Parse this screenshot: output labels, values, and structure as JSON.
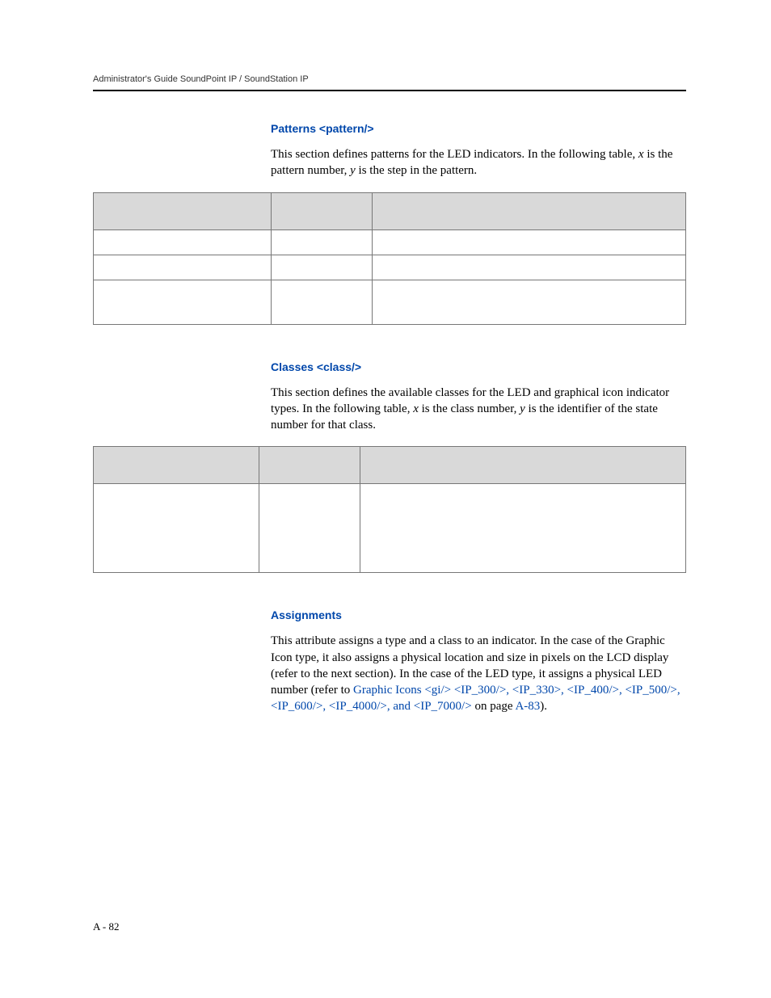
{
  "header": {
    "running_head": "Administrator's Guide SoundPoint IP / SoundStation IP"
  },
  "sections": {
    "patterns": {
      "heading": "Patterns <pattern/>",
      "body_pre": "This section defines patterns for the LED indicators. In the following table, ",
      "body_x": "x",
      "body_mid": " is the pattern number, ",
      "body_y": "y",
      "body_post": " is the step in the pattern."
    },
    "classes": {
      "heading": "Classes <class/>",
      "body_pre": "This section defines the available classes for the LED and graphical icon indicator types. In the following table, ",
      "body_x": "x",
      "body_mid": " is the class number, ",
      "body_y": "y",
      "body_post": " is the identifier of the state number for that class."
    },
    "assignments": {
      "heading": "Assignments",
      "body_1": "This attribute assigns a type and a class to an indicator. In the case of the Graphic Icon type, it also assigns a physical location and size in pixels on the LCD display (refer to the next section). In the case of the LED type, it assigns a physical LED number (refer to ",
      "link": "Graphic Icons <gi/> <IP_300/>, <IP_330>, <IP_400/>, <IP_500/>, <IP_600/>, <IP_4000/>, and <IP_7000/>",
      "body_2": " on page ",
      "page_ref": "A-83",
      "body_3": ")."
    }
  },
  "footer": {
    "page_number": "A - 82"
  }
}
